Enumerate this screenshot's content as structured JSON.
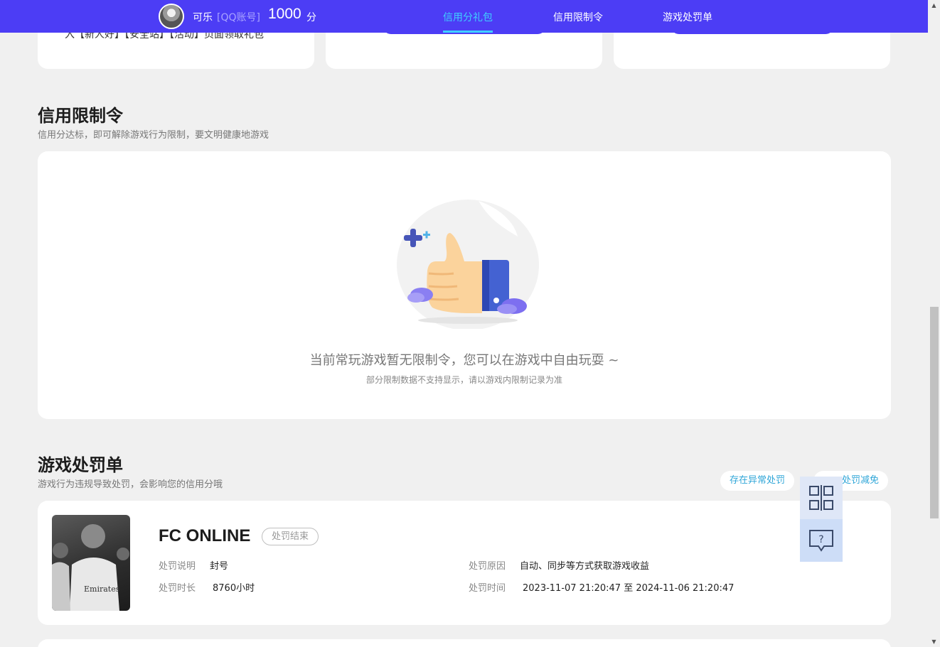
{
  "header": {
    "user_name": "可乐",
    "account_type": "[QQ账号]",
    "score": "1000",
    "score_unit": "分",
    "tabs": [
      {
        "label": "信用分礼包",
        "active": true
      },
      {
        "label": "信用限制令",
        "active": false
      },
      {
        "label": "游戏处罚单",
        "active": false
      }
    ]
  },
  "gift_cards": {
    "card1_text": "入【新人好】【安全站】【活动】页面领取礼包"
  },
  "restriction": {
    "title": "信用限制令",
    "subtitle": "信用分达标，即可解除游戏行为限制，要文明健康地游戏",
    "empty_title": "当前常玩游戏暂无限制令，您可以在游戏中自由玩耍 ~",
    "empty_note": "部分限制数据不支持显示，请以游戏内限制记录为准"
  },
  "penalty": {
    "title": "游戏处罚单",
    "subtitle": "游戏行为违规导致处罚，会影响您的信用分哦",
    "abnormal_button": "存在异常处罚",
    "reduction_button": "处罚减免",
    "game": {
      "name": "FC ONLINE",
      "status": "处罚结束",
      "desc_label": "处罚说明",
      "desc_value": "封号",
      "duration_label": "处罚时长",
      "duration_value": "8760小时",
      "reason_label": "处罚原因",
      "reason_value": "自动、同步等方式获取游戏收益",
      "time_label": "处罚时间",
      "time_value": "2023-11-07 21:20:47 至 2024-11-06 21:20:47"
    }
  },
  "colors": {
    "brand": "#4c3df5",
    "active_tab": "#3fd0ff",
    "link": "#2fa6d8"
  }
}
